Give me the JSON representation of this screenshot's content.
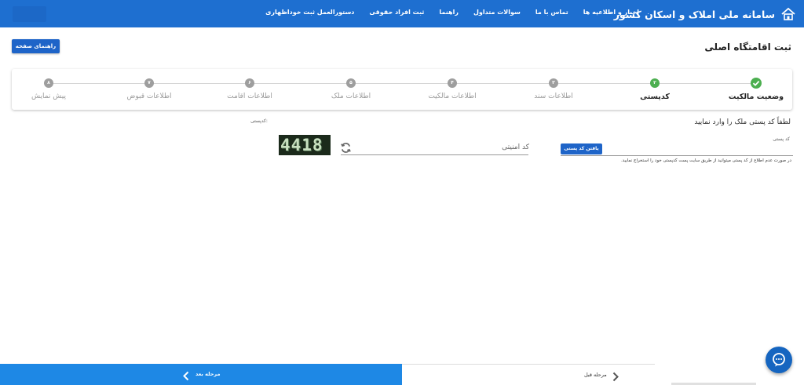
{
  "header": {
    "title": "سامانه ملی املاک و اسکان کشور",
    "nav_links": [
      "اخبار و اطلاعیه ها",
      "تماس با ما",
      "سوالات متداول",
      "راهنما",
      "ثبت افراد حقوقی",
      "دستورالعمل ثبت خوداظهاری"
    ],
    "logo_icon": "house-icon",
    "accent_color": "#1e6fd0"
  },
  "page": {
    "title": "ثبت اقامتگاه اصلی",
    "help_button": "راهنمای صفحه"
  },
  "stepper": {
    "steps": [
      {
        "label": "وضعیت مالکیت",
        "marker": "",
        "state": "done"
      },
      {
        "label": "کدپستی",
        "marker": "۲",
        "state": "active"
      },
      {
        "label": "اطلاعات سند",
        "marker": "۳",
        "state": "pending"
      },
      {
        "label": "اطلاعات مالکیت",
        "marker": "۴",
        "state": "pending"
      },
      {
        "label": "اطلاعات ملک",
        "marker": "۵",
        "state": "pending"
      },
      {
        "label": "اطلاعات اقامت",
        "marker": "۶",
        "state": "pending"
      },
      {
        "label": "اطلاعات قبوض",
        "marker": "۷",
        "state": "pending"
      },
      {
        "label": "پیش نمایش",
        "marker": "۸",
        "state": "pending"
      }
    ]
  },
  "form": {
    "postal_hint": "لطفاً کد پستی ملک را وارد نمایید",
    "postal_label": "کد پستی",
    "postal_value": "",
    "find_button": "یافتن کد پستی",
    "postal_note": "در صورت عدم اطلاع از کد پستی میتوانید از طریق سایت پست کدپستی خود را استخراج نمایید.",
    "postalcode_display_label": "کدپستی:",
    "captcha_text": "4418",
    "captcha_placeholder": "کد امنیتی",
    "captcha_value": ""
  },
  "footer": {
    "next_label": "مرحله بعد",
    "prev_label": "مرحله قبل",
    "next_color": "#1e88e5"
  },
  "chat": {
    "icon": "chat-bubble-icon"
  }
}
